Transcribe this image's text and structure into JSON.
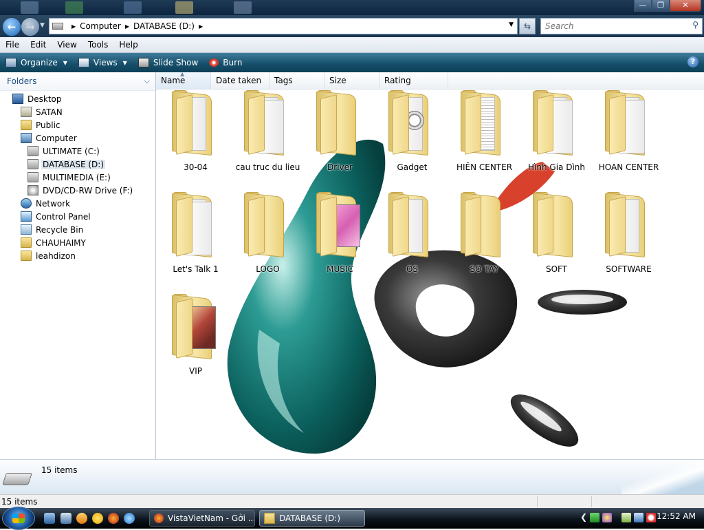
{
  "window": {
    "controls": {
      "minimize": "—",
      "maximize": "❐",
      "close": "✕"
    }
  },
  "address": {
    "crumbs": [
      "Computer",
      "DATABASE (D:)"
    ],
    "search_placeholder": "Search"
  },
  "menu": [
    "File",
    "Edit",
    "View",
    "Tools",
    "Help"
  ],
  "toolbar": {
    "organize": "Organize",
    "views": "Views",
    "slideshow": "Slide Show",
    "burn": "Burn",
    "help": "?"
  },
  "folders_pane": {
    "title": "Folders",
    "tree": [
      {
        "label": "Desktop",
        "icon": "desktop-icon"
      },
      {
        "label": "SATAN",
        "icon": "user-folder-icon"
      },
      {
        "label": "Public",
        "icon": "folder-icon"
      },
      {
        "label": "Computer",
        "icon": "computer-icon"
      },
      {
        "label": "ULTIMATE (C:)",
        "icon": "drive-icon"
      },
      {
        "label": "DATABASE (D:)",
        "icon": "drive-icon",
        "selected": true
      },
      {
        "label": "MULTIMEDIA (E:)",
        "icon": "drive-icon"
      },
      {
        "label": "DVD/CD-RW Drive (F:)",
        "icon": "dvd-drive-icon"
      },
      {
        "label": "Network",
        "icon": "network-icon"
      },
      {
        "label": "Control Panel",
        "icon": "control-panel-icon"
      },
      {
        "label": "Recycle Bin",
        "icon": "recycle-bin-icon"
      },
      {
        "label": "CHAUHAIMY",
        "icon": "folder-icon"
      },
      {
        "label": "leahdizon",
        "icon": "folder-icon"
      }
    ]
  },
  "columns": [
    "Name",
    "Date taken",
    "Tags",
    "Size",
    "Rating"
  ],
  "files": [
    {
      "name": "30-04",
      "thumb": "papers"
    },
    {
      "name": "cau truc du lieu",
      "thumb": "papers"
    },
    {
      "name": "Driver",
      "thumb": "empty"
    },
    {
      "name": "Gadget",
      "thumb": "clock"
    },
    {
      "name": "HIÊN CENTER",
      "thumb": "papers"
    },
    {
      "name": "Hình Gia Dình",
      "thumb": "papers"
    },
    {
      "name": "HOAN CENTER",
      "thumb": "papers"
    },
    {
      "name": "Let's Talk 1",
      "thumb": "papers"
    },
    {
      "name": "LOGO",
      "thumb": "empty"
    },
    {
      "name": "MUSIC",
      "thumb": "pink-photo"
    },
    {
      "name": "OS",
      "thumb": "papers"
    },
    {
      "name": "SO TAY",
      "thumb": "empty"
    },
    {
      "name": "SOFT",
      "thumb": "empty"
    },
    {
      "name": "SOFTWARE",
      "thumb": "papers"
    },
    {
      "name": "VIP",
      "thumb": "red-photo"
    }
  ],
  "details": {
    "item_count": "15 items"
  },
  "status": {
    "text": "15 items"
  },
  "taskbar": {
    "tasks": [
      "VistaVietNam - Gởi ...",
      "DATABASE (D:)"
    ],
    "clock": "12:52 AM"
  },
  "colors": {
    "wallpaper_teal": "#0f7f7a",
    "wallpaper_red": "#d8412b",
    "wallpaper_dark": "#2b2b2b",
    "toolbar": "#17506c"
  }
}
